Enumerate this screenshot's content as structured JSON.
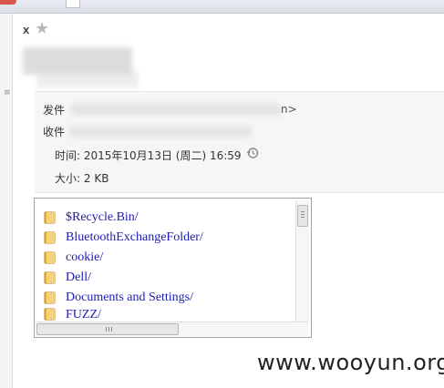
{
  "toolbar": {
    "close_label": "x",
    "star_icon": "star-icon"
  },
  "header": {
    "from_label": "发件",
    "from_tail": "n>",
    "to_label": "收件",
    "time_label": "时间:",
    "time_value": "2015年10月13日 (周二) 16:59",
    "size_label": "大小:",
    "size_value": "2 KB",
    "history_icon": "clock-history-icon"
  },
  "attachment": {
    "items": [
      {
        "label": "$Recycle.Bin/",
        "icon": "folder-icon"
      },
      {
        "label": "BluetoothExchangeFolder/",
        "icon": "folder-icon"
      },
      {
        "label": "cookie/",
        "icon": "folder-icon"
      },
      {
        "label": "Dell/",
        "icon": "folder-icon"
      },
      {
        "label": "Documents and Settings/",
        "icon": "folder-icon"
      },
      {
        "label": "FUZZ/",
        "icon": "folder-icon"
      }
    ]
  },
  "watermark": "www.wooyun.org",
  "colors": {
    "link": "#1b1bb0",
    "header_bg": "#f4f6f8",
    "folder": "#e8b93a"
  }
}
